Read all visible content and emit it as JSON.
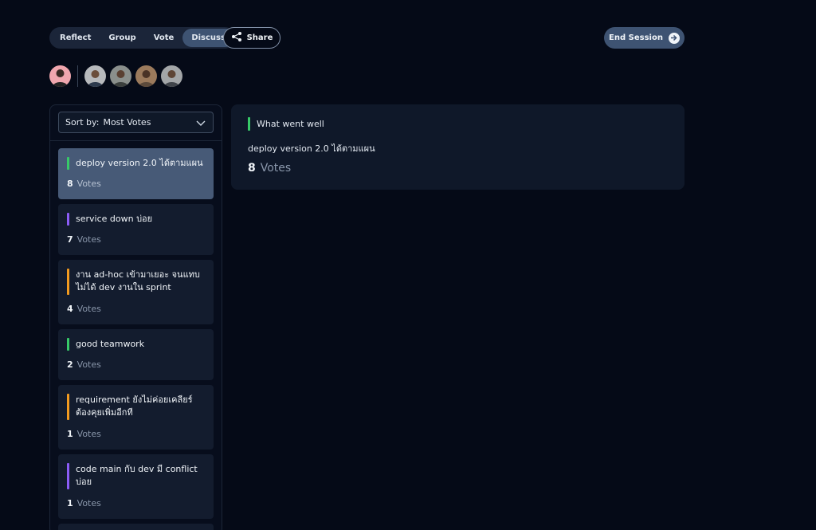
{
  "stages": [
    {
      "label": "Reflect",
      "active": false
    },
    {
      "label": "Group",
      "active": false
    },
    {
      "label": "Vote",
      "active": false
    },
    {
      "label": "Discuss",
      "active": true
    }
  ],
  "share_label": "Share",
  "end_session_label": "End Session",
  "sort": {
    "prefix": "Sort by:",
    "value": "Most Votes"
  },
  "votes_label": "Votes",
  "items": [
    {
      "text": "deploy version 2.0 ได้ตามแผน",
      "votes": "8",
      "color": "#37c968",
      "selected": true
    },
    {
      "text": "service down บ่อย",
      "votes": "7",
      "color": "#8b5cf6",
      "selected": false
    },
    {
      "text": "งาน ad-hoc เข้ามาเยอะ จนแทบไม่ได้ dev งานใน sprint",
      "votes": "4",
      "color": "#f29a1f",
      "selected": false
    },
    {
      "text": "good teamwork",
      "votes": "2",
      "color": "#37c968",
      "selected": false
    },
    {
      "text": "requirement ยังไม่ค่อยเคลียร์ ต้องคุยเพิ่มอีกที",
      "votes": "1",
      "color": "#f29a1f",
      "selected": false
    },
    {
      "text": "code main กับ dev มี conflict บ่อย",
      "votes": "1",
      "color": "#8b5cf6",
      "selected": false
    }
  ],
  "detail": {
    "column_title": "What went well",
    "content": "deploy version 2.0 ได้ตามแผน",
    "votes": "8"
  },
  "colors": {
    "background": "#050a17",
    "accent": "#3e5372",
    "went_well": "#37c968",
    "to_improve": "#f29a1f",
    "issue": "#8b5cf6"
  }
}
